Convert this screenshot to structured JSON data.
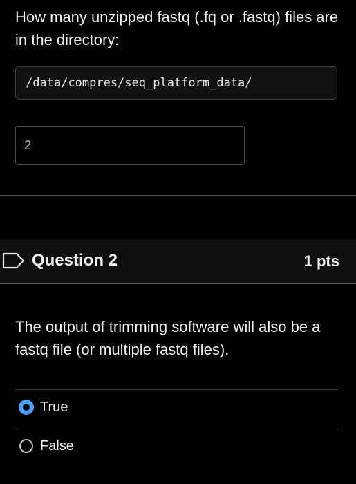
{
  "question1": {
    "prompt": "How many unzipped fastq (.fq or .fastq) files are in the directory:",
    "code_path": "/data/compres/seq_platform_data/",
    "answer_value": "2"
  },
  "question2": {
    "title": "Question 2",
    "points": "1 pts",
    "prompt": "The output of trimming software will also be a fastq file (or multiple fastq files).",
    "options": [
      {
        "label": "True",
        "selected": true
      },
      {
        "label": "False",
        "selected": false
      }
    ]
  },
  "colors": {
    "background": "#000000",
    "accent": "#4aa3ff",
    "text": "#f0f0f0"
  },
  "icons": {
    "question_flag": "flag-outline-icon"
  }
}
